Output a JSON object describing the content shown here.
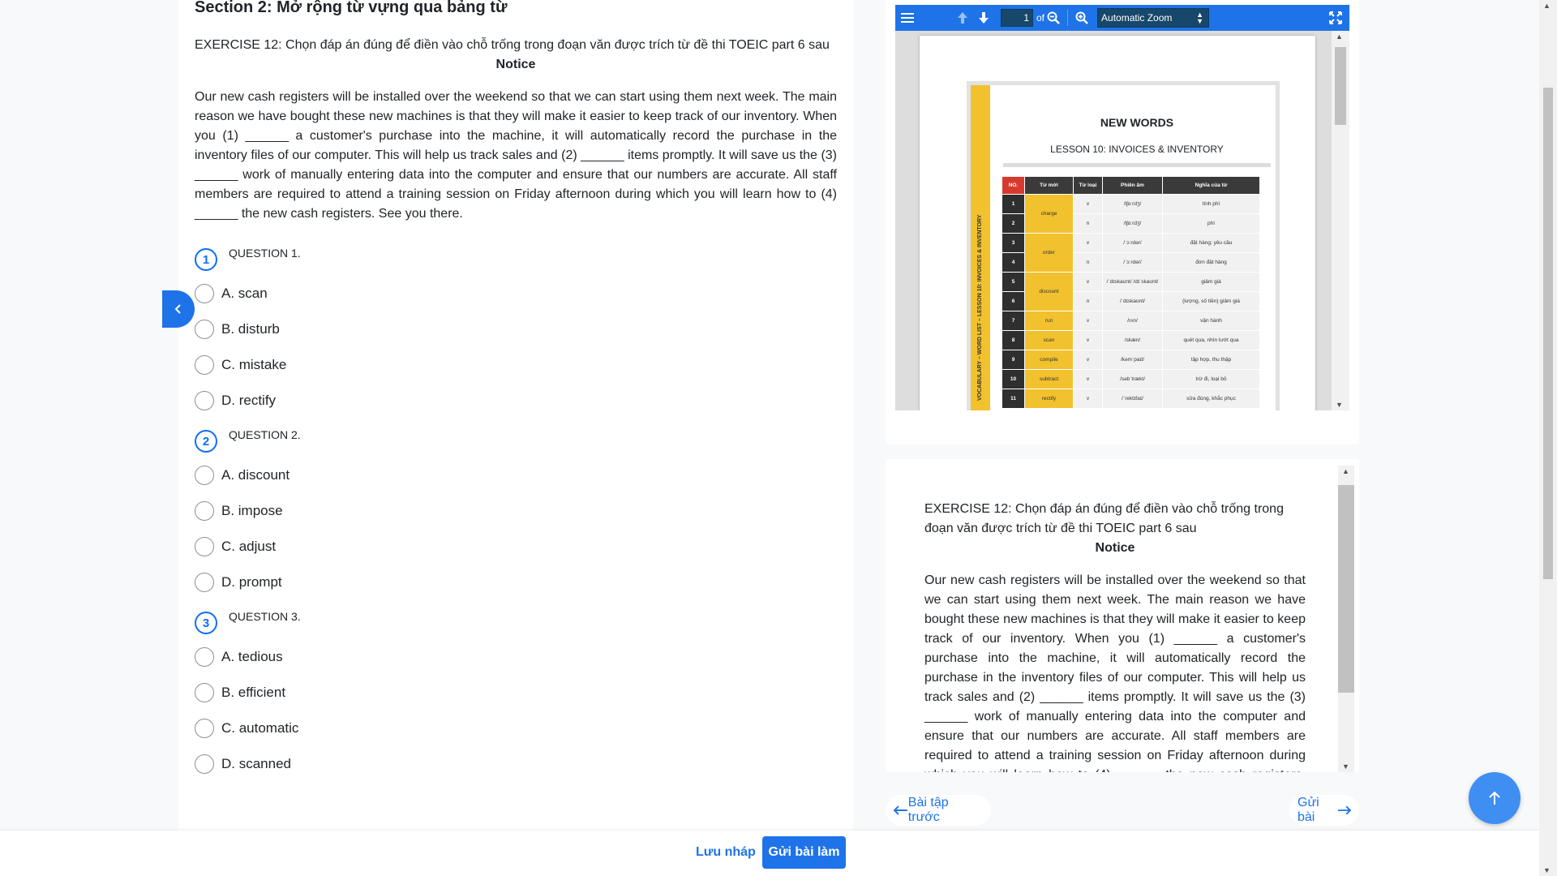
{
  "section": {
    "title": "Section 2: Mở rộng từ vựng qua bảng từ",
    "exercise_title": "EXERCISE 12: Chọn đáp án đúng để điền vào chỗ trống trong đoạn văn được trích từ đề thi TOEIC part 6 sau",
    "notice_title": "Notice",
    "paragraph": "Our new cash registers will be installed over the weekend so that we can start using them next week. The main reason we have bought these new machines is that they will make it easier to keep track of our inventory. When you (1) ______ a customer's purchase into the machine, it will automatically record the purchase in the inventory files of our computer. This will help us track sales and (2) ______ items promptly. It will save us the (3) ______ work of manually entering data into the computer and ensure that our numbers are accurate. All staff members are required to attend a training session on Friday afternoon during which you will learn how to (4) ______ the new cash registers. See you there."
  },
  "questions": [
    {
      "number": "1",
      "label": "QUESTION 1.",
      "options": [
        "A. scan",
        "B. disturb",
        "C. mistake",
        "D. rectify"
      ]
    },
    {
      "number": "2",
      "label": "QUESTION 2.",
      "options": [
        "A. discount",
        "B. impose",
        "C. adjust",
        "D. prompt"
      ]
    },
    {
      "number": "3",
      "label": "QUESTION 3.",
      "options": [
        "A. tedious",
        "B. efficient",
        "C. automatic",
        "D. scanned"
      ]
    }
  ],
  "pdf_viewer": {
    "page_number": "1",
    "of_label": "of",
    "zoom_label": "Automatic Zoom",
    "doc": {
      "title": "NEW WORDS",
      "subtitle": "LESSON 10: INVOICES & INVENTORY",
      "side_label": "VOCABULARY – WORD LIST – LESSON 10: INVOICES & INVENTORY",
      "headers": [
        "NO.",
        "Từ mới",
        "Từ loại",
        "Phiên âm",
        "Nghĩa của từ"
      ],
      "rows": [
        [
          "1",
          "charge",
          "v",
          "/tʃɑːrdʒ/",
          "tính phí"
        ],
        [
          "2",
          "",
          "n",
          "/tʃɑːrdʒ/",
          "phí"
        ],
        [
          "3",
          "order",
          "v",
          "/ˈɔːrdər/",
          "đặt hàng; yêu cầu"
        ],
        [
          "4",
          "",
          "n",
          "/ˈɔːrdər/",
          "đơn đặt hàng"
        ],
        [
          "5",
          "discount",
          "v",
          "/ˈdɪskaʊnt/ /dɪˈskaʊnt/",
          "giảm giá"
        ],
        [
          "6",
          "",
          "n",
          "/ˈdɪskaʊnt/",
          "(lượng, số tiền) giảm giá"
        ],
        [
          "7",
          "run",
          "v",
          "/rʌn/",
          "vận hành"
        ],
        [
          "8",
          "scan",
          "v",
          "/skæn/",
          "quét qua, nhìn lướt qua"
        ],
        [
          "9",
          "compile",
          "v",
          "/kəmˈpaɪl/",
          "tập hợp, thu thập"
        ],
        [
          "10",
          "subtract",
          "v",
          "/səbˈtrækt/",
          "trừ đi, loại bỏ"
        ],
        [
          "11",
          "rectify",
          "v",
          "/ˈrektɪfaɪ/",
          "sửa đúng, khắc phục"
        ]
      ]
    }
  },
  "navigation": {
    "prev_label": "Bài tập trước",
    "next_label": "Gửi bài"
  },
  "footer": {
    "draft_label": "Lưu nháp",
    "submit_label": "Gửi bài làm"
  },
  "colors": {
    "accent": "#1e73e8",
    "fab": "#3f8ef2",
    "highlight": "#f2c12e"
  }
}
